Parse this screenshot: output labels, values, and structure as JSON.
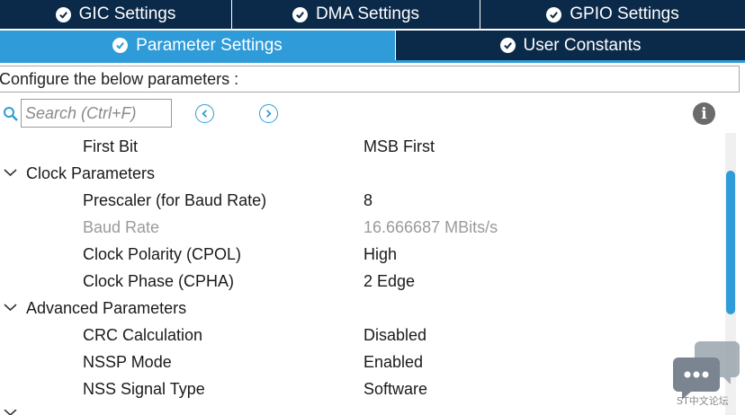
{
  "tabs_row1": [
    {
      "label": "GIC Settings"
    },
    {
      "label": "DMA Settings"
    },
    {
      "label": "GPIO Settings"
    }
  ],
  "tabs_row2": [
    {
      "label": "Parameter Settings",
      "active": true
    },
    {
      "label": "User Constants",
      "active": false
    }
  ],
  "config_label": "Configure the below parameters :",
  "search": {
    "placeholder": "Search (Ctrl+F)"
  },
  "parameters": {
    "first_bit": {
      "name": "First Bit",
      "value": "MSB First"
    },
    "clock_group": "Clock Parameters",
    "prescaler": {
      "name": "Prescaler (for Baud Rate)",
      "value": "8"
    },
    "baud_rate": {
      "name": "Baud Rate",
      "value": "16.666687 MBits/s"
    },
    "cpol": {
      "name": "Clock Polarity (CPOL)",
      "value": "High"
    },
    "cpha": {
      "name": "Clock Phase (CPHA)",
      "value": "2 Edge"
    },
    "advanced_group": "Advanced Parameters",
    "crc": {
      "name": "CRC Calculation",
      "value": "Disabled"
    },
    "nssp": {
      "name": "NSSP Mode",
      "value": "Enabled"
    },
    "nss_type": {
      "name": "NSS Signal Type",
      "value": "Software"
    }
  },
  "watermark_text": "ST中文论坛",
  "colors": {
    "tab_dark": "#0b2a4a",
    "tab_active": "#2f9bd8",
    "dim_text": "#9a9a9a"
  },
  "icons": [
    "check-circle-icon",
    "search-icon",
    "chevron-left-icon",
    "chevron-right-icon",
    "info-icon",
    "chevron-down-icon",
    "chat-bubble-icon"
  ]
}
